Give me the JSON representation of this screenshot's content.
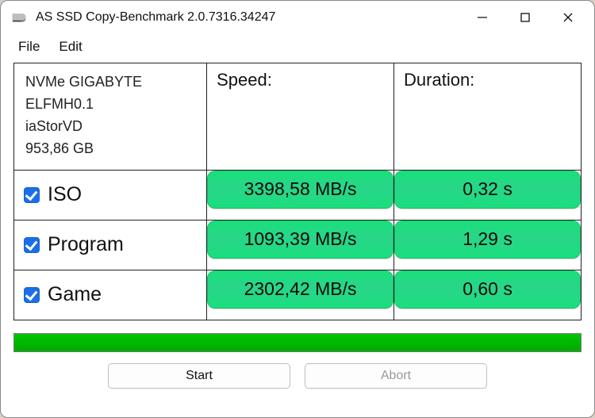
{
  "window": {
    "title": "AS SSD Copy-Benchmark 2.0.7316.34247"
  },
  "menu": {
    "file": "File",
    "edit": "Edit"
  },
  "drive": {
    "name": "NVMe GIGABYTE",
    "firmware": "ELFMH0.1",
    "driver": "iaStorVD",
    "capacity": "953,86 GB"
  },
  "headers": {
    "speed": "Speed:",
    "duration": "Duration:"
  },
  "rows": [
    {
      "label": "ISO",
      "checked": true,
      "speed": "3398,58 MB/s",
      "duration": "0,32 s"
    },
    {
      "label": "Program",
      "checked": true,
      "speed": "1093,39 MB/s",
      "duration": "1,29 s"
    },
    {
      "label": "Game",
      "checked": true,
      "speed": "2302,42 MB/s",
      "duration": "0,60 s"
    }
  ],
  "buttons": {
    "start": "Start",
    "abort": "Abort"
  }
}
